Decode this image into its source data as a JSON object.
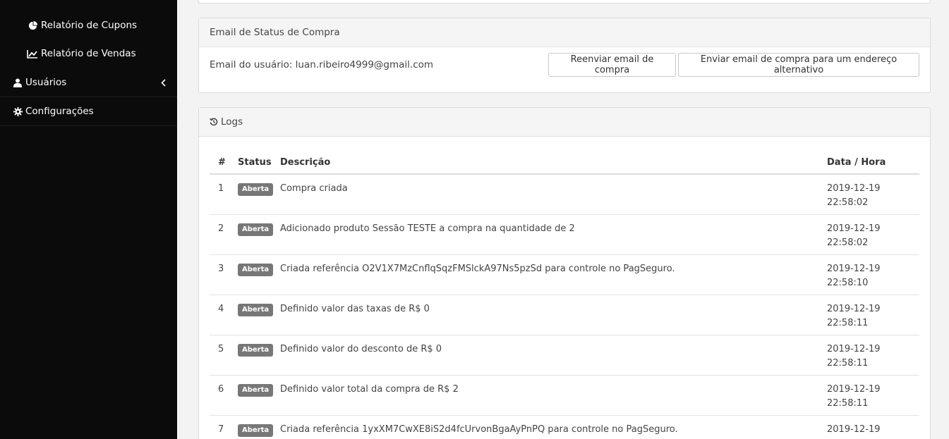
{
  "sidebar": {
    "sub_items": [
      {
        "label": "Relatório de Cupons",
        "icon": "pie-chart-icon"
      },
      {
        "label": "Relatório de Vendas",
        "icon": "line-chart-icon"
      }
    ],
    "items": [
      {
        "label": "Usuários",
        "icon": "user-icon"
      },
      {
        "label": "Configurações",
        "icon": "gear-icon"
      }
    ]
  },
  "email_panel": {
    "title": "Email de Status de Compra",
    "user_email_text": "Email do usuário: luan.ribeiro4999@gmail.com",
    "resend_label": "Reenviar email de compra",
    "alt_label": "Enviar email de compra para um endereço alternativo"
  },
  "logs_panel": {
    "title": "Logs",
    "columns": [
      "#",
      "Status",
      "Descrição",
      "Data / Hora"
    ],
    "rows": [
      {
        "n": "1",
        "status": "Aberta",
        "desc": "Compra criada",
        "date": "2019-12-19",
        "time": "22:58:02"
      },
      {
        "n": "2",
        "status": "Aberta",
        "desc": "Adicionado produto Sessão TESTE a compra na quantidade de 2",
        "date": "2019-12-19",
        "time": "22:58:02"
      },
      {
        "n": "3",
        "status": "Aberta",
        "desc": "Criada referência O2V1X7MzCnflqSqzFMSlckA97Ns5pzSd para controle no PagSeguro.",
        "date": "2019-12-19",
        "time": "22:58:10"
      },
      {
        "n": "4",
        "status": "Aberta",
        "desc": "Definido valor das taxas de R$ 0",
        "date": "2019-12-19",
        "time": "22:58:11"
      },
      {
        "n": "5",
        "status": "Aberta",
        "desc": "Definido valor do desconto de R$ 0",
        "date": "2019-12-19",
        "time": "22:58:11"
      },
      {
        "n": "6",
        "status": "Aberta",
        "desc": "Definido valor total da compra de R$ 2",
        "date": "2019-12-19",
        "time": "22:58:11"
      },
      {
        "n": "7",
        "status": "Aberta",
        "desc": "Criada referência 1yxXM7CwXE8iS2d4fcUrvonBgaAyPnPQ para controle no PagSeguro.",
        "date": "2019-12-19",
        "time": ""
      }
    ]
  },
  "colors": {
    "sidebar_bg": "#0b0b0b",
    "badge_bg": "#777777"
  }
}
